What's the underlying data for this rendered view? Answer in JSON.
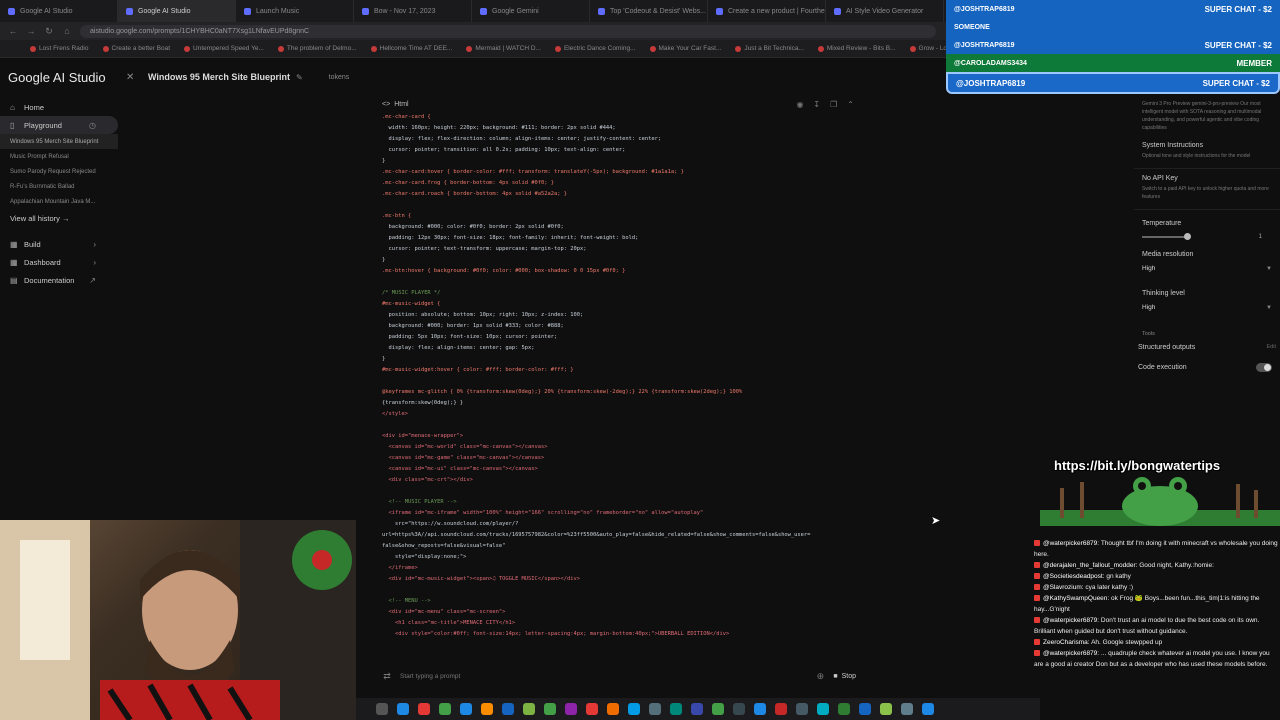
{
  "browser": {
    "tabs": [
      {
        "label": "Google AI Studio",
        "active": false
      },
      {
        "label": "Google AI Studio",
        "active": true
      },
      {
        "label": "Launch Music",
        "active": false
      },
      {
        "label": "Bow - Nov 17, 2023",
        "active": false
      },
      {
        "label": "Google Gemini",
        "active": false
      },
      {
        "label": "Top 'Codeout & Desist' Webs...",
        "active": false
      },
      {
        "label": "Create a new product | Fourthe...",
        "active": false
      },
      {
        "label": "AI Style Video Generator",
        "active": false
      }
    ],
    "url": "aistudio.google.com/prompts/1CHYBHC0aNT7Xsg1LNfavEUPd8gnnC",
    "bookmarks": [
      "Lost Frens Radio",
      "Create a better Boat",
      "Untempered Speed Ye...",
      "The problem of Delmo...",
      "Hellcome Time AT DEE...",
      "Mermaid | WATCH D...",
      "Electric Dance Coming...",
      "Make Your Car Fast...",
      "Just a Bit Technica...",
      "Mixed Review - Bits B...",
      "Grow - Lodgie Ma..."
    ]
  },
  "app": {
    "logo": "Google AI Studio",
    "project_title": "Windows 95 Merch Site Blueprint",
    "tokens_label": "tokens"
  },
  "sidebar": {
    "home": "Home",
    "playground": "Playground",
    "history": [
      "Windows 95 Merch Site Blueprint",
      "Music Prompt Refusal",
      "Sumo Parody Request Rejected",
      "R-Fu's Burnmatic Ballad",
      "Appalachian Mountain Java M..."
    ],
    "view_all": "View all history →",
    "build": "Build",
    "dashboard": "Dashboard",
    "documentation": "Documentation"
  },
  "code_panel": {
    "lang_label": "Html",
    "lines": [
      {
        "cls": "c-sel",
        "text": ".mc-char-card {"
      },
      {
        "cls": "",
        "text": "  width: 160px; height: 220px; background: #111; border: 2px solid #444;"
      },
      {
        "cls": "",
        "text": "  display: flex; flex-direction: column; align-items: center; justify-content: center;"
      },
      {
        "cls": "",
        "text": "  cursor: pointer; transition: all 0.2s; padding: 10px; text-align: center;"
      },
      {
        "cls": "",
        "text": "}"
      },
      {
        "cls": "c-sel",
        "text": ".mc-char-card:hover { border-color: #fff; transform: translateY(-5px); background: #1a1a1a; }"
      },
      {
        "cls": "c-sel",
        "text": ".mc-char-card.frog { border-bottom: 4px solid #0f0; }"
      },
      {
        "cls": "c-sel",
        "text": ".mc-char-card.roach { border-bottom: 4px solid #a52a2a; }"
      },
      {
        "cls": "",
        "text": ""
      },
      {
        "cls": "c-sel",
        "text": ".mc-btn {"
      },
      {
        "cls": "",
        "text": "  background: #000; color: #0f0; border: 2px solid #0f0;"
      },
      {
        "cls": "",
        "text": "  padding: 12px 30px; font-size: 18px; font-family: inherit; font-weight: bold;"
      },
      {
        "cls": "",
        "text": "  cursor: pointer; text-transform: uppercase; margin-top: 20px;"
      },
      {
        "cls": "",
        "text": "}"
      },
      {
        "cls": "c-sel",
        "text": ".mc-btn:hover { background: #0f0; color: #000; box-shadow: 0 0 15px #0f0; }"
      },
      {
        "cls": "",
        "text": ""
      },
      {
        "cls": "c-com",
        "text": "/* MUSIC PLAYER */"
      },
      {
        "cls": "c-sel",
        "text": "#mc-music-widget {"
      },
      {
        "cls": "",
        "text": "  position: absolute; bottom: 10px; right: 10px; z-index: 100;"
      },
      {
        "cls": "",
        "text": "  background: #000; border: 1px solid #333; color: #888;"
      },
      {
        "cls": "",
        "text": "  padding: 5px 10px; font-size: 10px; cursor: pointer;"
      },
      {
        "cls": "",
        "text": "  display: flex; align-items: center; gap: 5px;"
      },
      {
        "cls": "",
        "text": "}"
      },
      {
        "cls": "c-sel",
        "text": "#mc-music-widget:hover { color: #fff; border-color: #fff; }"
      },
      {
        "cls": "",
        "text": ""
      },
      {
        "cls": "c-sel",
        "text": "@keyframes mc-glitch { 0% {transform:skew(0deg);} 20% {transform:skew(-2deg);} 22% {transform:skew(2deg);} 100%"
      },
      {
        "cls": "",
        "text": "{transform:skew(0deg);} }"
      },
      {
        "cls": "c-tag",
        "text": "</style>"
      },
      {
        "cls": "",
        "text": ""
      },
      {
        "cls": "c-tag",
        "text": "<div id=\"menace-wrapper\">"
      },
      {
        "cls": "c-tag",
        "text": "  <canvas id=\"mc-world\" class=\"mc-canvas\"></canvas>"
      },
      {
        "cls": "c-tag",
        "text": "  <canvas id=\"mc-game\" class=\"mc-canvas\"></canvas>"
      },
      {
        "cls": "c-tag",
        "text": "  <canvas id=\"mc-ui\" class=\"mc-canvas\"></canvas>"
      },
      {
        "cls": "c-tag",
        "text": "  <div class=\"mc-crt\"></div>"
      },
      {
        "cls": "",
        "text": ""
      },
      {
        "cls": "c-com",
        "text": "  <!-- MUSIC PLAYER -->"
      },
      {
        "cls": "c-tag",
        "text": "  <iframe id=\"mc-iframe\" width=\"100%\" height=\"166\" scrolling=\"no\" frameborder=\"no\" allow=\"autoplay\""
      },
      {
        "cls": "",
        "text": "    src=\"https://w.soundcloud.com/player/?"
      },
      {
        "cls": "",
        "text": "url=https%3A//api.soundcloud.com/tracks/1695757982&color=%23ff5500&auto_play=false&hide_related=false&show_comments=false&show_user="
      },
      {
        "cls": "",
        "text": "false&show_reposts=false&visual=false\""
      },
      {
        "cls": "",
        "text": "    style=\"display:none;\">"
      },
      {
        "cls": "c-tag",
        "text": "  </iframe>"
      },
      {
        "cls": "c-tag",
        "text": "  <div id=\"mc-music-widget\"><span>♫ TOGGLE MUSIC</span></div>"
      },
      {
        "cls": "",
        "text": ""
      },
      {
        "cls": "c-com",
        "text": "  <!-- MENU -->"
      },
      {
        "cls": "c-tag",
        "text": "  <div id=\"mc-menu\" class=\"mc-screen\">"
      },
      {
        "cls": "c-tag",
        "text": "    <h1 class=\"mc-title\">MENACE CITY</h1>"
      },
      {
        "cls": "c-tag",
        "text": "    <div style=\"color:#0ff; font-size:14px; letter-spacing:4px; margin-bottom:40px;\">UBERBALL EDITION</div>"
      }
    ]
  },
  "prompt": {
    "placeholder": "Start typing a prompt",
    "stop_label": "Stop"
  },
  "settings": {
    "model_desc": "Gemini 3 Pro Preview gemini-3-pro-preview Our most intelligent model with SOTA reasoning and multimodal understanding, and powerful agentic and vibe coding capabilities",
    "system_instructions": "System Instructions",
    "system_instructions_sub": "Optional tone and style instructions for the model",
    "no_api_key": "No API Key",
    "no_api_key_sub": "Switch to a paid API key to unlock higher quota and more features",
    "temperature": "Temperature",
    "temperature_value": "1",
    "temperature_fraction": 1.0,
    "media_resolution": "Media resolution",
    "media_resolution_value": "High",
    "thinking_level": "Thinking level",
    "thinking_level_value": "High",
    "tools": "Tools",
    "structured_outputs": "Structured outputs",
    "structured_outputs_edit": "Edit",
    "code_execution": "Code execution"
  },
  "super_chats": [
    {
      "user": "@JOSHTRAP6819",
      "amount": "SUPER CHAT - $2",
      "style": "blue"
    },
    {
      "user": "SOMEONE",
      "amount": "",
      "style": "blue"
    },
    {
      "user": "@JOSHTRAP6819",
      "amount": "SUPER CHAT - $2",
      "style": "blue"
    },
    {
      "user": "@CAROLADAMS3434",
      "amount": "MEMBER",
      "style": "green"
    },
    {
      "user": "@JOSHTRAP6819",
      "amount": "SUPER CHAT - $2",
      "style": "big"
    }
  ],
  "promo_text": "https://bit.ly/bongwatertips",
  "chat": [
    {
      "user": "@waterpicker6879:",
      "text": "Thought tbf I'm doing it with minecraft vs wholesale you doing here."
    },
    {
      "user": "@derajalen_the_fallout_modder:",
      "text": "Good night, Kathy.:homie:"
    },
    {
      "user": "@Societiesdeadpost:",
      "text": "gn kathy"
    },
    {
      "user": "@Slavrozium:",
      "text": "cya later kathy :)"
    },
    {
      "user": "@KathySwampQueen:",
      "text": "ok Frog 🐸 Boys...been fun...this_tim|1:is hitting the hay...G'night"
    },
    {
      "user": "@waterpicker6879:",
      "text": "Don't trust an ai model to due the best code on its own. Brilliant when guided but don't trust without guidance."
    },
    {
      "user": "ZeeroCharisma:",
      "text": "Ah. Google stewpped up"
    },
    {
      "user": "@waterpicker6879:",
      "text": "... quadruple check whatever ai model you use. I know you are a good ai creator Don but as a developer who has used these models before."
    }
  ]
}
